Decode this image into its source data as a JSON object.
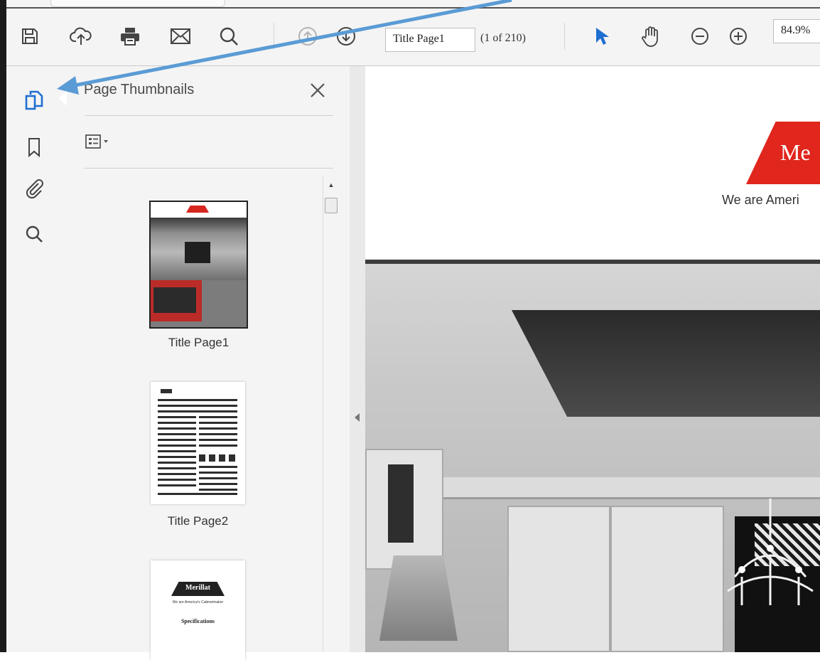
{
  "toolbar": {
    "page_field": "Title Page1",
    "page_count": "(1 of 210)",
    "zoom_value": "84.9%",
    "icons": [
      "save-icon",
      "upload-icon",
      "print-icon",
      "email-icon",
      "search-icon",
      "previous-page-icon",
      "next-page-icon",
      "select-tool-icon",
      "hand-tool-icon",
      "zoom-out-icon",
      "zoom-in-icon"
    ]
  },
  "rail": {
    "icons": [
      "page-thumbnails-icon",
      "bookmark-icon",
      "attachment-icon",
      "search-icon"
    ]
  },
  "panel": {
    "title": "Page Thumbnails",
    "thumbnails": [
      {
        "label": "Title Page1"
      },
      {
        "label": "Title Page2"
      },
      {
        "logo_text": "Merillat",
        "tagline": "We are America's Cabinetmaker",
        "heading": "Specifications"
      }
    ]
  },
  "document": {
    "logo_text": "Me",
    "tagline": "We are Ameri"
  },
  "colors": {
    "accent_blue": "#1f6fd1",
    "annotation_arrow": "#5a9bd5",
    "brand_red": "#e0261d"
  }
}
